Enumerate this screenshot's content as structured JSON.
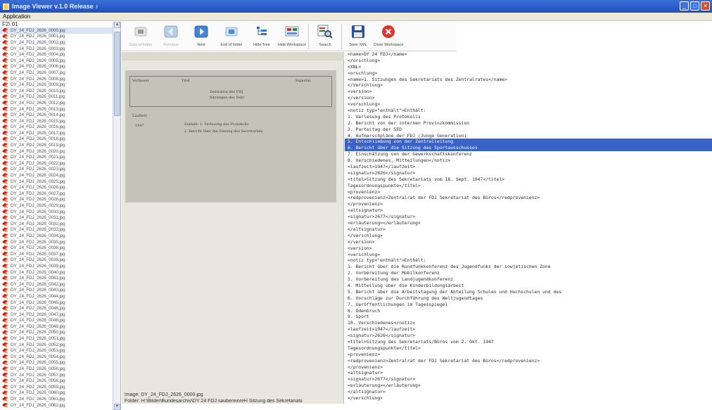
{
  "window": {
    "title": "Image Viewer v.1.0 Release ♪",
    "controls": [
      "_",
      "□",
      "✕"
    ]
  },
  "menubar": {
    "label": "Application"
  },
  "file_panel": {
    "root": "F2\\ 01",
    "selected_index": 0,
    "items": [
      "DY_24_FDJ_2626_0000.jpg",
      "DY_24_FDJ_2626_0001.jpg",
      "DY_24_FDJ_2626_0002.jpg",
      "DY_24_FDJ_2626_0003.jpg",
      "DY_24_FDJ_2626_0004.jpg",
      "DY_24_FDJ_2626_0005.jpg",
      "DY_24_FDJ_2626_0006.jpg",
      "DY_24_FDJ_2626_0007.jpg",
      "DY_24_FDJ_2626_0008.jpg",
      "DY_24_FDJ_2626_0009.jpg",
      "DY_24_FDJ_2626_0010.jpg",
      "DY_24_FDJ_2626_0011.jpg",
      "DY_24_FDJ_2626_0012.jpg",
      "DY_24_FDJ_2626_0013.jpg",
      "DY_24_FDJ_2626_0014.jpg",
      "DY_24_FDJ_2626_0015.jpg",
      "DY_24_FDJ_2626_0016.jpg",
      "DY_24_FDJ_2626_0017.jpg",
      "DY_24_FDJ_2626_0018.jpg",
      "DY_24_FDJ_2626_0019.jpg",
      "DY_24_FDJ_2626_0020.jpg",
      "DY_24_FDJ_2626_0021.jpg",
      "DY_24_FDJ_2626_0022.jpg",
      "DY_24_FDJ_2626_0023.jpg",
      "DY_24_FDJ_2626_0024.jpg",
      "DY_24_FDJ_2626_0025.jpg",
      "DY_24_FDJ_2626_0026.jpg",
      "DY_24_FDJ_2626_0027.jpg",
      "DY_24_FDJ_2626_0028.jpg",
      "DY_24_FDJ_2626_0029.jpg",
      "DY_24_FDJ_2626_0030.jpg",
      "DY_24_FDJ_2626_0031.jpg",
      "DY_24_FDJ_2626_0032.jpg",
      "DY_24_FDJ_2626_0033.jpg",
      "DY_24_FDJ_2626_0034.jpg",
      "DY_24_FDJ_2626_0035.jpg",
      "DY_24_FDJ_2626_0036.jpg",
      "DY_24_FDJ_2626_0037.jpg",
      "DY_24_FDJ_2626_0038.jpg",
      "DY_24_FDJ_2626_0039.jpg",
      "DY_24_FDJ_2626_0040.jpg",
      "DY_24_FDJ_2626_0041.jpg",
      "DY_24_FDJ_2626_0042.jpg",
      "DY_24_FDJ_2626_0043.jpg",
      "DY_24_FDJ_2626_0044.jpg",
      "DY_24_FDJ_2626_0045.jpg",
      "DY_24_FDJ_2626_0046.jpg",
      "DY_24_FDJ_2626_0047.jpg",
      "DY_24_FDJ_2626_0048.jpg",
      "DY_24_FDJ_2626_0049.jpg",
      "DY_24_FDJ_2626_0050.jpg",
      "DY_24_FDJ_2626_0051.jpg",
      "DY_24_FDJ_2626_0052.jpg",
      "DY_24_FDJ_2626_0053.jpg",
      "DY_24_FDJ_2626_0054.jpg",
      "DY_24_FDJ_2626_0055.jpg",
      "DY_24_FDJ_2626_0056.jpg",
      "DY_24_FDJ_2626_0057.jpg",
      "DY_24_FDJ_2626_0058.jpg",
      "DY_24_FDJ_2626_0059.jpg",
      "DY_24_FDJ_2626_0060.jpg",
      "DY_24_FDJ_2626_0061.jpg",
      "DY_24_FDJ_2626_0062.jpg"
    ]
  },
  "toolbar": {
    "buttons": [
      {
        "name": "start-of-folder-button",
        "label": "Start of folder",
        "icon": "start-icon",
        "enabled": false
      },
      {
        "name": "previous-button",
        "label": "Previous",
        "icon": "arrow-left-icon",
        "enabled": false
      },
      {
        "name": "next-button",
        "label": "Next",
        "icon": "arrow-right-icon",
        "enabled": true
      },
      {
        "name": "end-of-folder-button",
        "label": "End of folder",
        "icon": "end-icon",
        "enabled": true
      },
      {
        "name": "hide-tree-button",
        "label": "Hide Tree",
        "icon": "tree-icon",
        "enabled": true
      },
      {
        "name": "hide-workspace-button",
        "label": "Hide Workspace",
        "icon": "workspace-icon",
        "enabled": true
      },
      {
        "name": "search-button",
        "label": "Search",
        "icon": "search-icon",
        "enabled": true
      },
      {
        "name": "save-xml-button",
        "label": "Save XML",
        "icon": "floppy-disk-icon",
        "enabled": true
      },
      {
        "name": "close-workspace-button",
        "label": "Close Workspace",
        "icon": "close-circle-icon",
        "enabled": true
      }
    ]
  },
  "viewer": {
    "doc_texts": [
      "Verfasser",
      "Titel",
      "Signatur",
      "Zentralrat der FDJ",
      "Sitzungen des Sekr.",
      "Laufzeit",
      "Enthält: 1. Verlesung des Protokolls",
      "2. Bericht über die Sitzung des Secretariats",
      "1947"
    ],
    "image_label": "Image:",
    "image_value": "DY_24_FDJ_2626_0000.jpg",
    "folder_label": "Folder:",
    "folder_value": "H:\\Bilder\\Bundesarchiv\\DY 24 FDJ saubereinreH Sitzung des Sekretariats"
  },
  "xml": {
    "selected_lines": [
      14,
      15
    ],
    "lines": [
      "<name>DY 24 FDJ</name>",
      "</orschlung>",
      "<XNL>",
      "<orschlung>",
      "<name>1. Sitzungen des Sekretariats des Zentralrates</name>",
      "</Verschlung>",
      "<version>",
      "</version>",
      "<vorschlung>",
      "<notiz typ=\"enthält\">Enthält:",
      "1. Verlesung des Protokolls",
      "2. Bericht von der internen Provinzkommission",
      "3. Parteitag der SED",
      "4. Aufmarschpläne der FDJ (Junge Generation)",
      "5. Entschließung von der Zentralleitung",
      "6. Bericht über die Sitzung des Sportausschusses",
      "7. Einschätzung von der Gewerkschaftskonferenz",
      "8. Verschiedenes, Mitteilungen</notiz>",
      "<laufzeit>1947</laufzeit>",
      "<signatur>2626</signatur>",
      "<titel>Sitzung des Sekretariats vom 18. Sept. 1947</titel>",
      "Tagesordnungspunkte</titel>",
      "<provenienz>",
      "<redprovenienz>Zentralrat der FDJ Sekretariat des Büros</redprovenienz>",
      "</provenienz>",
      "<altsignatur>",
      "<signatur>2677</signatur>",
      "<erläuterung></erläuterung>",
      "</altsignatur>",
      "</verschlung>",
      "</version>",
      "<version>",
      "<verschlung>",
      "<notiz typ=\"enthält\">Enthält:",
      "1. Bericht über die Rundfunkkonferenz des Jugendfunks der sowjetischen Zone",
      "2. Vorbereitung der Mobilkonferenz",
      "3. Vorbereitung des Landjugendkonferenz",
      "4. Mitteilung über die Kinderbildungsarbeit",
      "5. Bericht über die Arbeitstagung der Abteilung Schulen und Hochschulen und des",
      "6. Vorschläge zur Durchführung des Weltjugendtages",
      "7. Veröffentlichungen im Tagesspiegel",
      "8. Odenbruch",
      "9. Sport",
      "10. Verschiedenes</notiz>",
      "<laufzeit>1947</laufzeit>",
      "<signatur>2626</signatur>",
      "<titel>Sitzung des Sekretariats/Büros vom 2. Okt. 1947",
      "Tagesordnungspunkte</titel>",
      "<provenienz>",
      "<redprovenienz>Zentralrat der FDJ Sekretariat des Büros</redprovenienz>",
      "</provenienz>",
      "<altsignatur>",
      "<signatur>2677</signatur>",
      "<erläuterung></erläuterung>",
      "</altsignatur>",
      "</verschlung>"
    ]
  }
}
